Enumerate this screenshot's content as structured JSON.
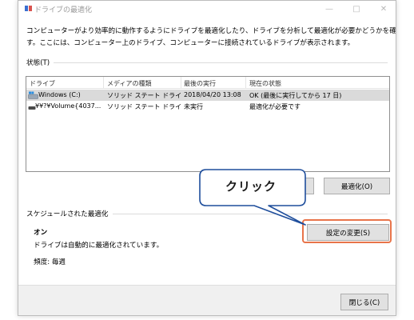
{
  "window": {
    "title": "ドライブの最適化",
    "description": "コンピューターがより効率的に動作するようにドライブを最適化したり、ドライブを分析して最適化が必要かどうかを確認したりできま\nす。ここには、コンピューター上のドライブ、コンピューターに接続されているドライブが表示されます。"
  },
  "status": {
    "label": "状態(T)",
    "columns": [
      "ドライブ",
      "メディアの種類",
      "最後の実行",
      "現在の状態"
    ],
    "rows": [
      {
        "drive": "Windows (C:)",
        "media": "ソリッド ステート ドライブ",
        "last_run": "2018/04/20 13:08",
        "state": "OK (最後に実行してから 17 日)",
        "selected": true
      },
      {
        "drive": "¥¥?¥Volume{4037...",
        "media": "ソリッド ステート ドライブ",
        "last_run": "未実行",
        "state": "最適化が必要です",
        "selected": false
      }
    ],
    "optimize_button": "最適化(O)"
  },
  "schedule": {
    "label": "スケジュールされた最適化",
    "state": "オン",
    "auto_text": "ドライブは自動的に最適化されています。",
    "frequency_text": "頻度: 毎週",
    "change_settings_button": "設定の変更(S)"
  },
  "footer": {
    "close_button": "閉じる(C)"
  },
  "annotation": {
    "callout_text": "クリック",
    "callout_fill": "#ffffff",
    "callout_stroke": "#1f4e9c",
    "highlight_color": "#e8744a"
  }
}
